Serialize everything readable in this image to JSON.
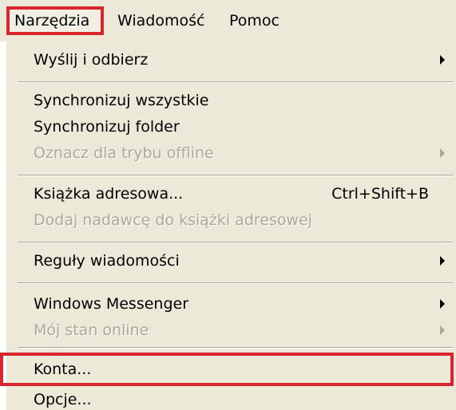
{
  "menubar": {
    "items": [
      {
        "label": "Narzędzia"
      },
      {
        "label": "Wiadomość"
      },
      {
        "label": "Pomoc"
      }
    ]
  },
  "dropdown": {
    "items": [
      {
        "label": "Wyślij i odbierz",
        "submenu": true,
        "enabled": true
      },
      {
        "label": "Synchronizuj wszystkie",
        "submenu": false,
        "enabled": true
      },
      {
        "label": "Synchronizuj folder",
        "submenu": false,
        "enabled": true
      },
      {
        "label": "Oznacz dla trybu offline",
        "submenu": true,
        "enabled": false
      },
      {
        "label": "Książka adresowa...",
        "shortcut": "Ctrl+Shift+B",
        "submenu": false,
        "enabled": true
      },
      {
        "label": "Dodaj nadawcę do książki adresowej",
        "submenu": false,
        "enabled": false
      },
      {
        "label": "Reguły wiadomości",
        "submenu": true,
        "enabled": true
      },
      {
        "label": "Windows Messenger",
        "submenu": true,
        "enabled": true
      },
      {
        "label": "Mój stan online",
        "submenu": true,
        "enabled": false
      },
      {
        "label": "Konta...",
        "submenu": false,
        "enabled": true,
        "highlighted": true
      },
      {
        "label": "Opcje...",
        "submenu": false,
        "enabled": true
      }
    ]
  },
  "colors": {
    "menu_background": "#ece9d8",
    "highlight_border": "#d8262f",
    "disabled_text": "#aca899"
  }
}
